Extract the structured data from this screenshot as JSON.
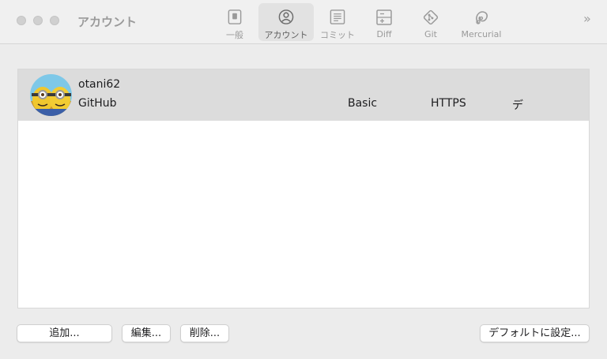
{
  "window": {
    "title": "アカウント"
  },
  "toolbar": {
    "items": [
      {
        "label": "一般",
        "icon": "switch-icon",
        "active": false
      },
      {
        "label": "アカウント",
        "icon": "person-circle-icon",
        "active": true
      },
      {
        "label": "コミット",
        "icon": "document-lines-icon",
        "active": false
      },
      {
        "label": "Diff",
        "icon": "diff-icon",
        "active": false
      },
      {
        "label": "Git",
        "icon": "git-diamond-icon",
        "active": false
      },
      {
        "label": "Mercurial",
        "icon": "mercurial-icon",
        "active": false
      }
    ],
    "overflow": "»"
  },
  "accounts": [
    {
      "username": "otani62",
      "host": "GitHub",
      "auth": "Basic",
      "protocol": "HTTPS",
      "default": "デ"
    }
  ],
  "buttons": {
    "add": "追加...",
    "edit": "編集...",
    "delete": "削除...",
    "set_default": "デフォルトに設定..."
  },
  "colors": {
    "selected_row": "#dcdcdc",
    "panel_bg": "#ffffff",
    "window_bg": "#ececec"
  }
}
